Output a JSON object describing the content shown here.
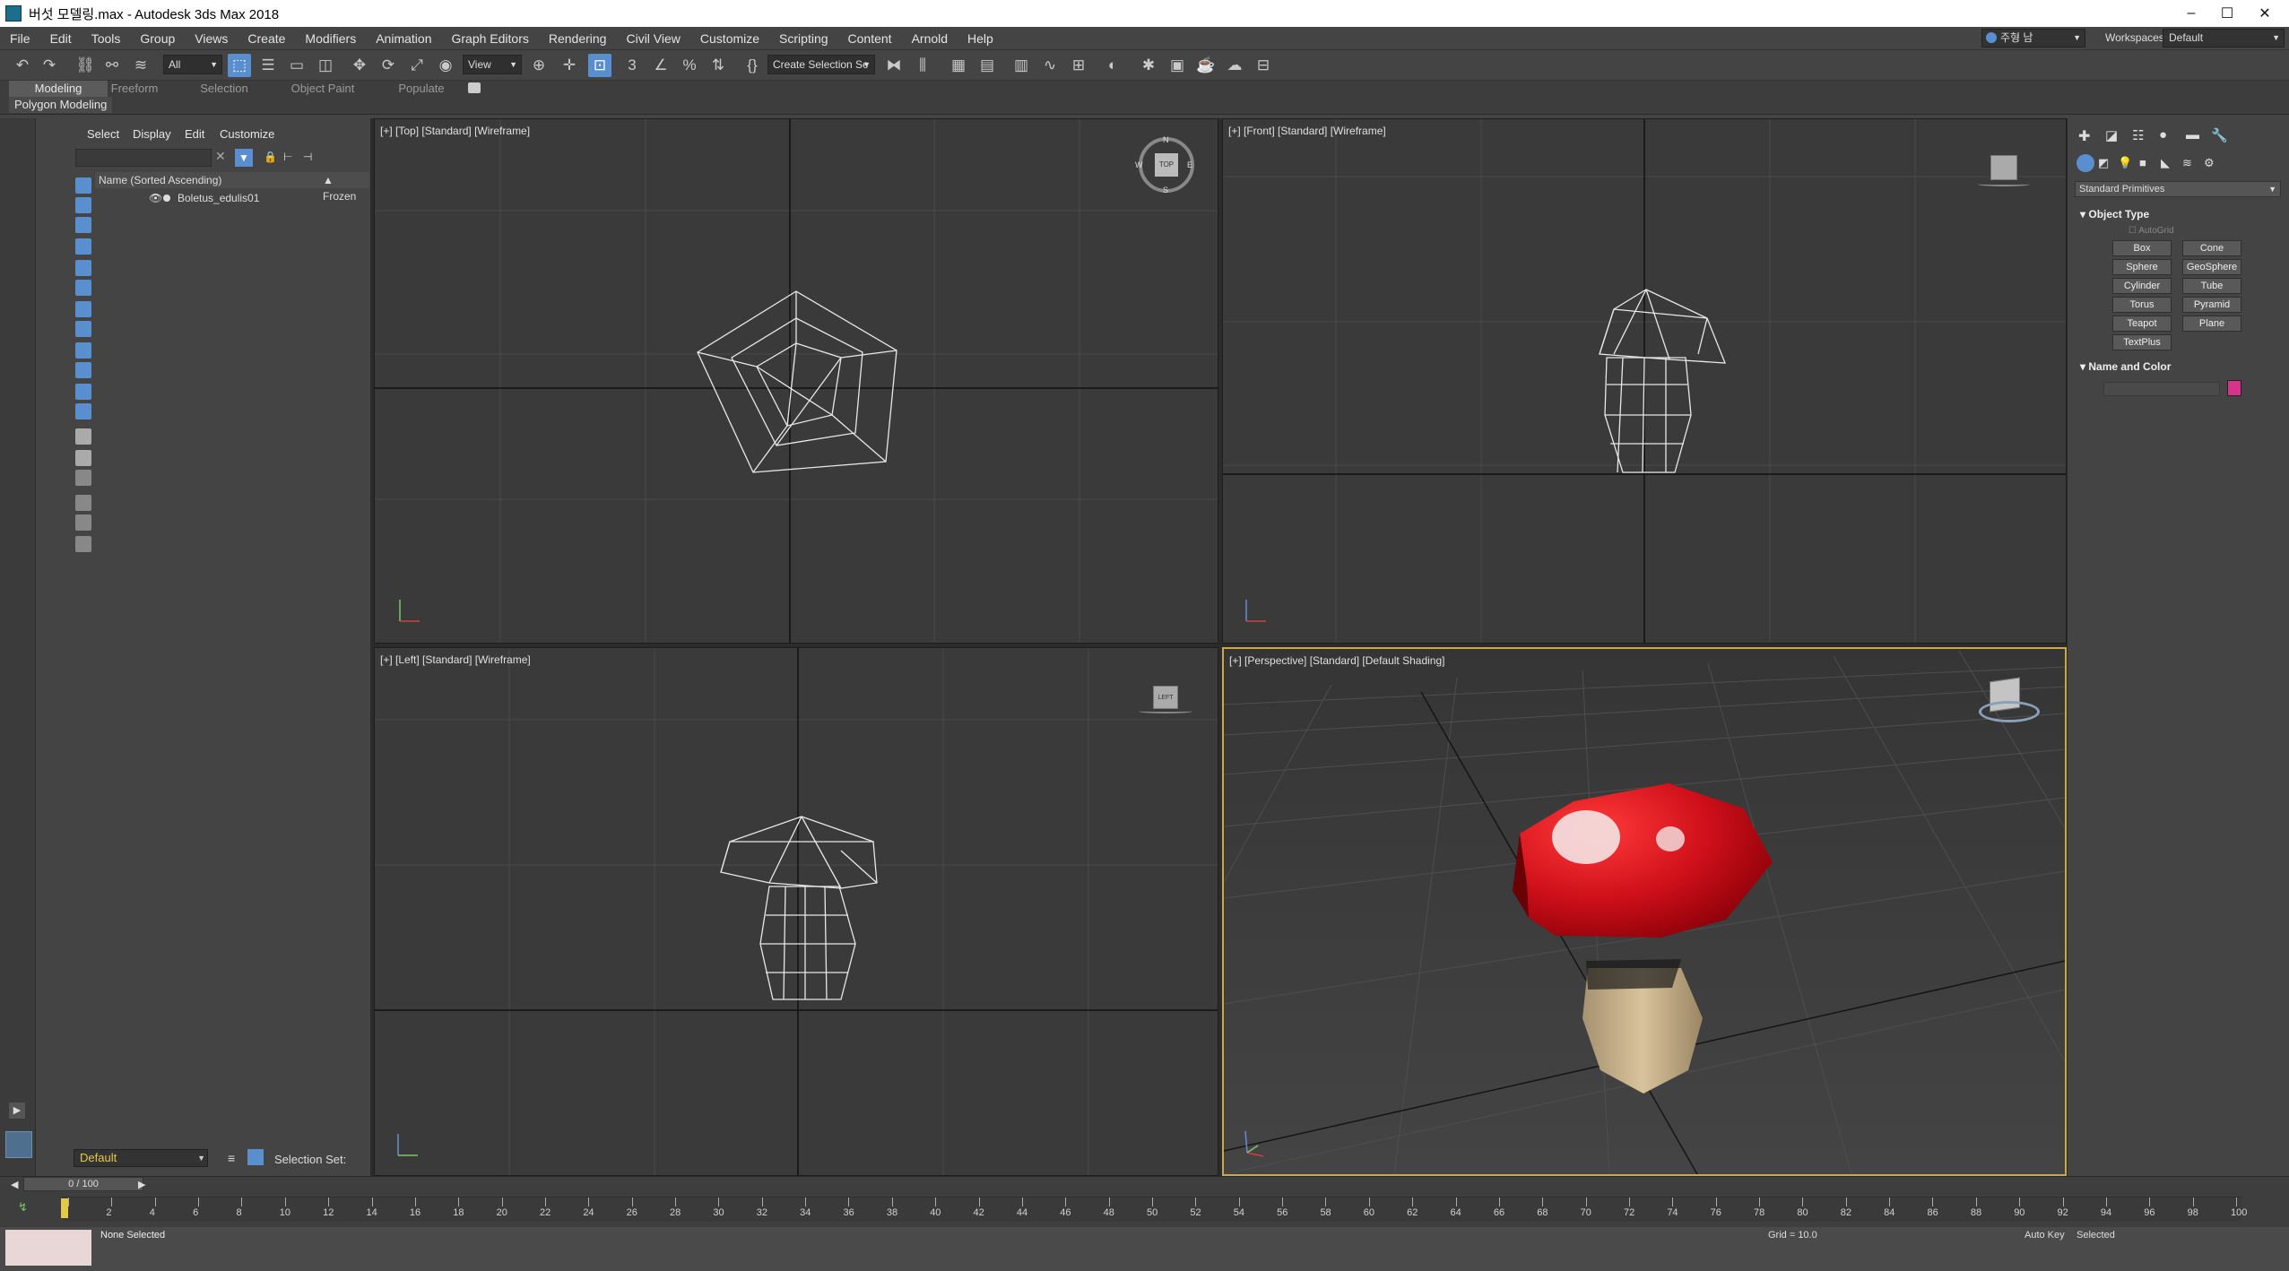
{
  "window": {
    "title": "버섯 모델링.max - Autodesk 3ds Max 2018",
    "minimize": "–",
    "maximize": "☐",
    "close": "✕"
  },
  "menu": [
    "File",
    "Edit",
    "Tools",
    "Group",
    "Views",
    "Create",
    "Modifiers",
    "Animation",
    "Graph Editors",
    "Rendering",
    "Civil View",
    "Customize",
    "Scripting",
    "Content",
    "Arnold",
    "Help"
  ],
  "user": {
    "name": "주형 남",
    "workspaces_label": "Workspaces:",
    "workspace_value": "Default"
  },
  "toolbar": {
    "filter_value": "All",
    "refcoord_value": "View",
    "selection_set_value": "Create Selection Se",
    "snap_label": "3",
    "percent_icon": "%"
  },
  "ribbon": {
    "tabs": [
      "Modeling",
      "Freeform",
      "Selection",
      "Object Paint",
      "Populate"
    ],
    "active_tab": "Modeling",
    "subtitle": "Polygon Modeling"
  },
  "scene_explorer": {
    "tabs": [
      "Select",
      "Display",
      "Edit",
      "Customize"
    ],
    "col_name": "Name (Sorted Ascending)",
    "col_frozen": "▲ Frozen",
    "objects": [
      "Boletus_edulis01"
    ],
    "layer_value": "Default",
    "selection_set_label": "Selection Set:"
  },
  "viewports": [
    {
      "label": "[+] [Top] [Standard] [Wireframe]"
    },
    {
      "label": "[+] [Front] [Standard] [Wireframe]"
    },
    {
      "label": "[+] [Left] [Standard] [Wireframe]"
    },
    {
      "label": "[+] [Perspective] [Standard] [Default Shading]"
    }
  ],
  "viewcube": {
    "top_label": "TOP",
    "n": "N",
    "s": "S",
    "e": "E",
    "w": "W",
    "left_label": "LEFT"
  },
  "colors": {
    "mushroom_cap": "#d0101a",
    "mushroom_stem": "#cbb690",
    "object_color": "#d6338a",
    "active_border": "#c9a94a",
    "selected_blue": "#5a8fcf"
  },
  "command_panel": {
    "category_value": "Standard Primitives",
    "object_type_title": "Object Type",
    "autogrid_label": "AutoGrid",
    "buttons": [
      "Box",
      "Cone",
      "Sphere",
      "GeoSphere",
      "Cylinder",
      "Tube",
      "Torus",
      "Pyramid",
      "Teapot",
      "Plane",
      "TextPlus"
    ],
    "name_color_title": "Name and Color"
  },
  "timeline": {
    "frame_readout": "0 / 100",
    "ticks": [
      "0",
      "2",
      "4",
      "6",
      "8",
      "10",
      "12",
      "14",
      "16",
      "18",
      "20",
      "22",
      "24",
      "26",
      "28",
      "30",
      "32",
      "34",
      "36",
      "38",
      "40",
      "42",
      "44",
      "46",
      "48",
      "50",
      "52",
      "54",
      "56",
      "58",
      "60",
      "62",
      "64",
      "66",
      "68",
      "70",
      "72",
      "74",
      "76",
      "78",
      "80",
      "82",
      "84",
      "86",
      "88",
      "90",
      "92",
      "94",
      "96",
      "98",
      "100"
    ]
  },
  "status": {
    "selection": "None Selected",
    "grid": "Grid = 10.0",
    "autokey": "Auto Key",
    "selected_value": "Selected"
  }
}
